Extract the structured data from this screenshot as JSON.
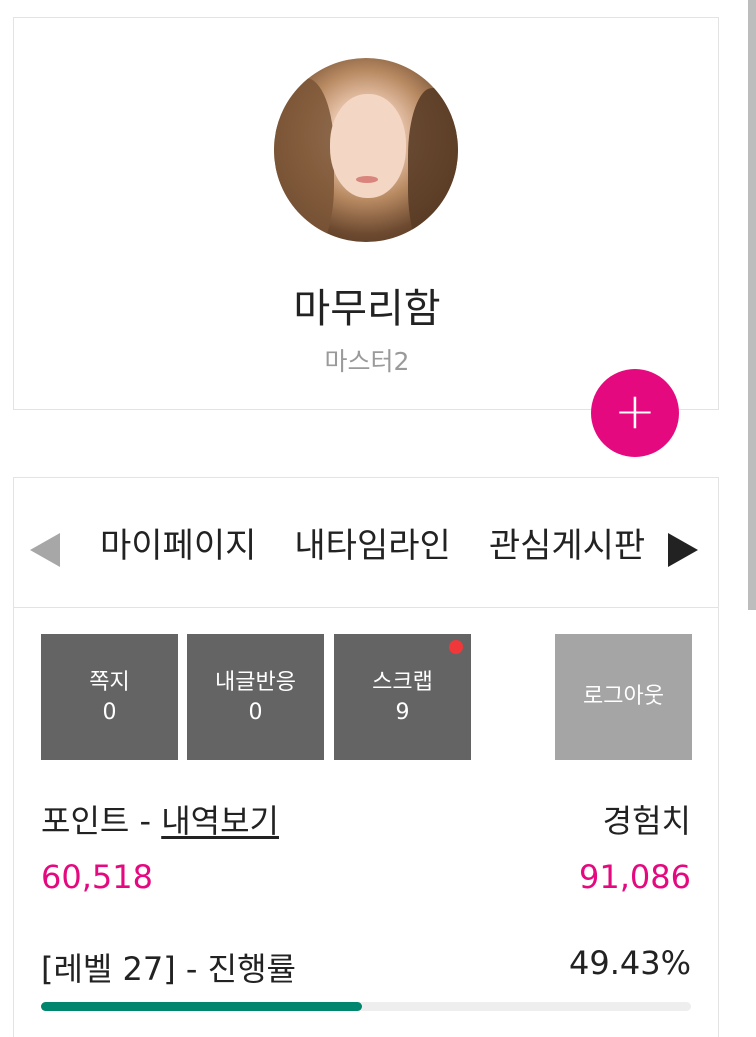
{
  "profile": {
    "name": "마무리함",
    "rank": "마스터2",
    "add_button_icon": "plus-icon",
    "add_button_glyph": "+"
  },
  "menu": {
    "tabs": [
      "마이페이지",
      "내타임라인",
      "관심게시판"
    ],
    "prev_icon": "triangle-left-icon",
    "next_icon": "triangle-right-icon"
  },
  "quick_buttons": [
    {
      "label": "쪽지",
      "count": "0"
    },
    {
      "label": "내글반응",
      "count": "0"
    },
    {
      "label": "스크랩",
      "count": "9",
      "has_notification": true
    }
  ],
  "logout_label": "로그아웃",
  "stats": {
    "point_label": "포인트 - ",
    "point_link": "내역보기",
    "point_value": "60,518",
    "exp_label": "경험치",
    "exp_value": "91,086",
    "level_label": "[레벨 27] - 진행률",
    "level_percent": "49.43%",
    "progress": 0.4943
  },
  "colors": {
    "accent": "#e5097f",
    "progress": "#00856e",
    "button_dark": "#646464",
    "button_light": "#a5a5a5",
    "notification": "#f0383a"
  }
}
